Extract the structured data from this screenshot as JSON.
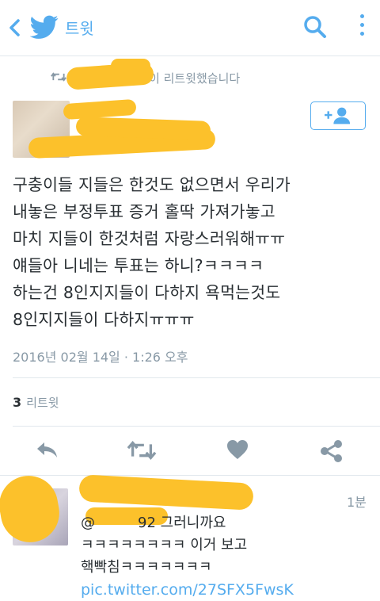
{
  "header": {
    "title": "트윗",
    "back_icon": "chevron-left-icon",
    "logo_icon": "twitter-bird-icon",
    "search_icon": "search-icon",
    "menu_icon": "more-vertical-icon",
    "accent": "#55acee"
  },
  "retweet": {
    "label": "이 리트윗했습니다",
    "icon": "retweet-icon"
  },
  "tweet": {
    "lines": [
      "구충이들 지들은 한것도 없으면서 우리가",
      "내놓은 부정투표 증거 홀딱 가져가놓고",
      "마치 지들이 한것처럼 자랑스러워해ㅠㅠ",
      "얘들아 니네는 투표는 하니?ㅋㅋㅋㅋ",
      "하는건 8인지지들이 다하지 욕먹는것도",
      "8인지지들이 다하지ㅠㅠㅠ"
    ],
    "timestamp": "2016년 02월 14일 · 1:26 오후",
    "retweet_count": "3",
    "retweet_label": "리트윗"
  },
  "actions": {
    "reply_icon": "reply-icon",
    "retweet_icon": "retweet-icon",
    "like_icon": "heart-icon",
    "share_icon": "share-icon"
  },
  "reply": {
    "time": "1분",
    "line1": "그러니까요",
    "line1_prefix": "@",
    "line1_handle_tail": "92",
    "line2": "ㅋㅋㅋㅋㅋㅋㅋㅋ 이거 보고",
    "line3": "핵빡침ㅋㅋㅋㅋㅋㅋㅋ",
    "link": "pic.twitter.com/27SFX5FwsK"
  },
  "colors": {
    "accent": "#55acee",
    "text": "#292f33",
    "muted": "#8899a6",
    "redaction": "#fcc12b"
  }
}
